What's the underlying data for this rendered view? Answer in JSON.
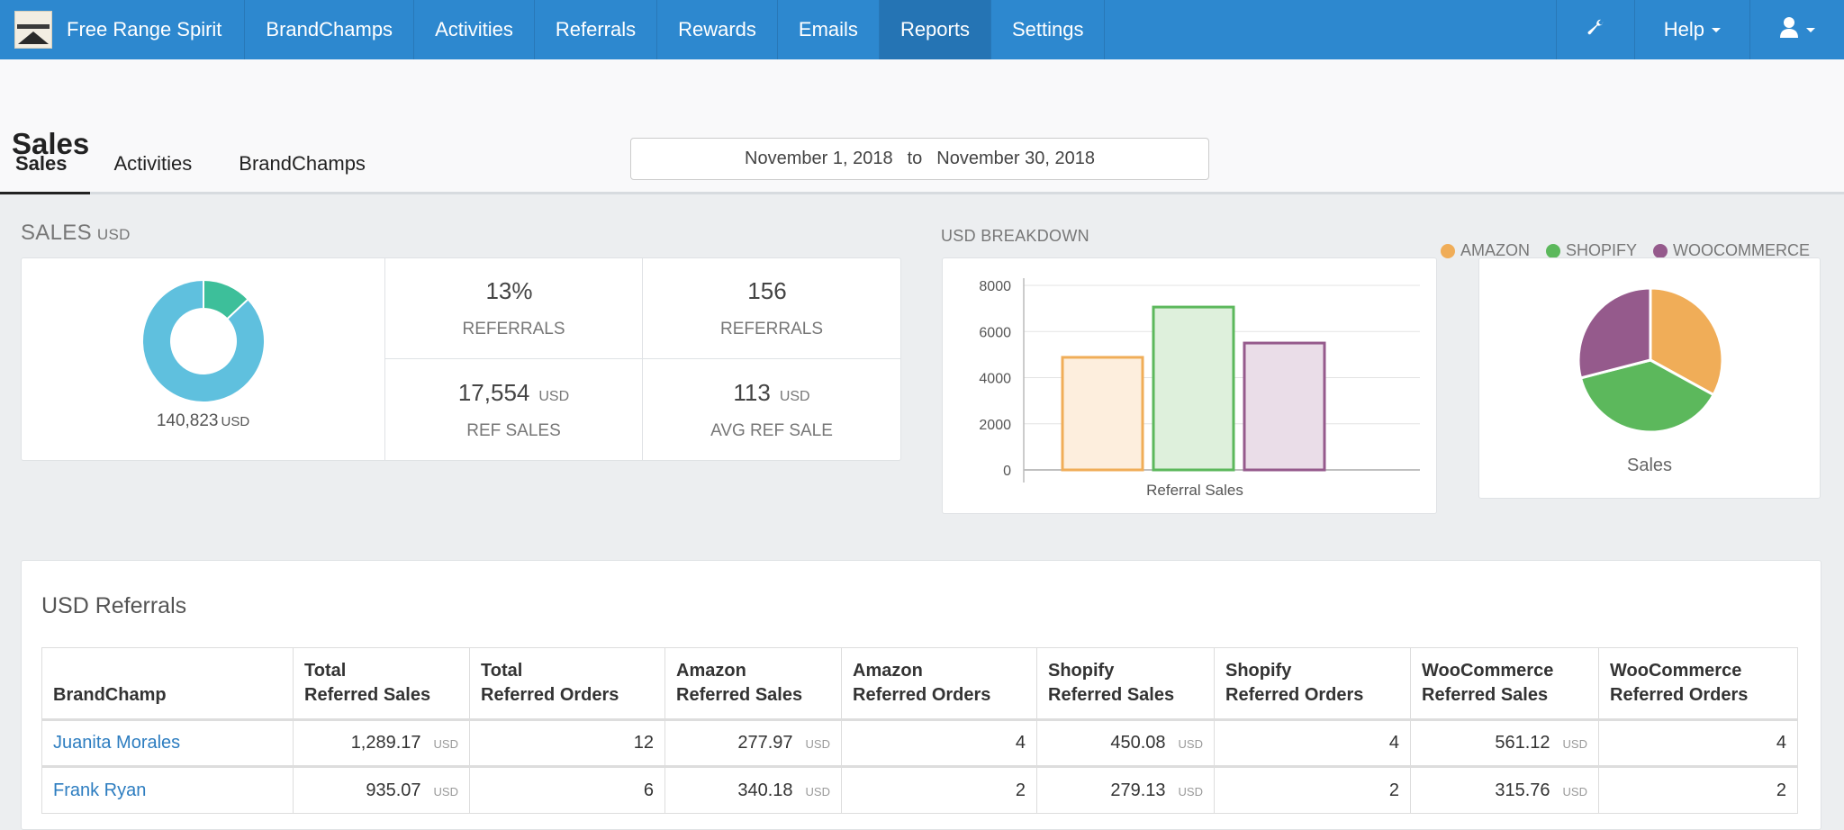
{
  "navbar": {
    "brand": "Free Range Spirit",
    "items": [
      {
        "label": "BrandChamps",
        "active": false
      },
      {
        "label": "Activities",
        "active": false
      },
      {
        "label": "Referrals",
        "active": false
      },
      {
        "label": "Rewards",
        "active": false
      },
      {
        "label": "Emails",
        "active": false
      },
      {
        "label": "Reports",
        "active": true
      },
      {
        "label": "Settings",
        "active": false
      }
    ],
    "tools_icon": "wrench-icon",
    "help_label": "Help",
    "user_icon": "user-icon"
  },
  "header": {
    "title": "Sales",
    "date_from": "November 1, 2018",
    "date_sep": "to",
    "date_to": "November 30, 2018",
    "tabs": [
      {
        "label": "Sales",
        "active": true
      },
      {
        "label": "Activities",
        "active": false
      },
      {
        "label": "BrandChamps",
        "active": false
      }
    ]
  },
  "sales_section": {
    "label": "SALES",
    "currency": "USD",
    "donut": {
      "total": "140,823",
      "currency": "USD",
      "referral_fraction": 0.13,
      "colors": {
        "referral": "#3dbf9a",
        "other": "#5fc0de"
      }
    },
    "stats": [
      {
        "value": "13%",
        "unit": "",
        "label": "REFERRALS"
      },
      {
        "value": "156",
        "unit": "",
        "label": "REFERRALS"
      },
      {
        "value": "17,554",
        "unit": "USD",
        "label": "REF SALES"
      },
      {
        "value": "113",
        "unit": "USD",
        "label": "AVG REF SALE"
      }
    ]
  },
  "breakdown": {
    "label": "USD BREAKDOWN",
    "legend": [
      {
        "label": "AMAZON",
        "color": "#f0ad58"
      },
      {
        "label": "SHOPIFY",
        "color": "#5cb85c"
      },
      {
        "label": "WOOCOMMERCE",
        "color": "#955a8c"
      }
    ],
    "pie_label": "Sales"
  },
  "chart_data": [
    {
      "type": "bar",
      "title": "",
      "categories": [
        "Referral Sales"
      ],
      "series": [
        {
          "name": "Amazon",
          "values": [
            4880
          ],
          "color": "#f0ad58",
          "fill": "#fdeedd"
        },
        {
          "name": "Shopify",
          "values": [
            7060
          ],
          "color": "#5cb85c",
          "fill": "#def0dc"
        },
        {
          "name": "WooCommerce",
          "values": [
            5500
          ],
          "color": "#955a8c",
          "fill": "#eadde8"
        }
      ],
      "xlabel": "Referral Sales",
      "ylabel": "",
      "ylim": [
        0,
        8000
      ],
      "yticks": [
        0,
        2000,
        4000,
        6000,
        8000
      ],
      "grid": true
    },
    {
      "type": "pie",
      "title": "Sales",
      "labels": [
        "Amazon",
        "Shopify",
        "WooCommerce"
      ],
      "values": [
        33,
        38,
        29
      ],
      "colors": [
        "#f0ad58",
        "#5cb85c",
        "#955a8c"
      ]
    }
  ],
  "referrals_table": {
    "title": "USD Referrals",
    "columns": [
      [
        "",
        "BrandChamp"
      ],
      [
        "Total",
        "Referred Sales"
      ],
      [
        "Total",
        "Referred Orders"
      ],
      [
        "Amazon",
        "Referred Sales"
      ],
      [
        "Amazon",
        "Referred Orders"
      ],
      [
        "Shopify",
        "Referred Sales"
      ],
      [
        "Shopify",
        "Referred Orders"
      ],
      [
        "WooCommerce",
        "Referred Sales"
      ],
      [
        "WooCommerce",
        "Referred Orders"
      ]
    ],
    "currency": "USD",
    "rows": [
      {
        "name": "Juanita Morales",
        "total_sales": "1,289.17",
        "total_orders": "12",
        "amazon_sales": "277.97",
        "amazon_orders": "4",
        "shopify_sales": "450.08",
        "shopify_orders": "4",
        "woo_sales": "561.12",
        "woo_orders": "4"
      },
      {
        "name": "Frank Ryan",
        "total_sales": "935.07",
        "total_orders": "6",
        "amazon_sales": "340.18",
        "amazon_orders": "2",
        "shopify_sales": "279.13",
        "shopify_orders": "2",
        "woo_sales": "315.76",
        "woo_orders": "2"
      }
    ]
  }
}
